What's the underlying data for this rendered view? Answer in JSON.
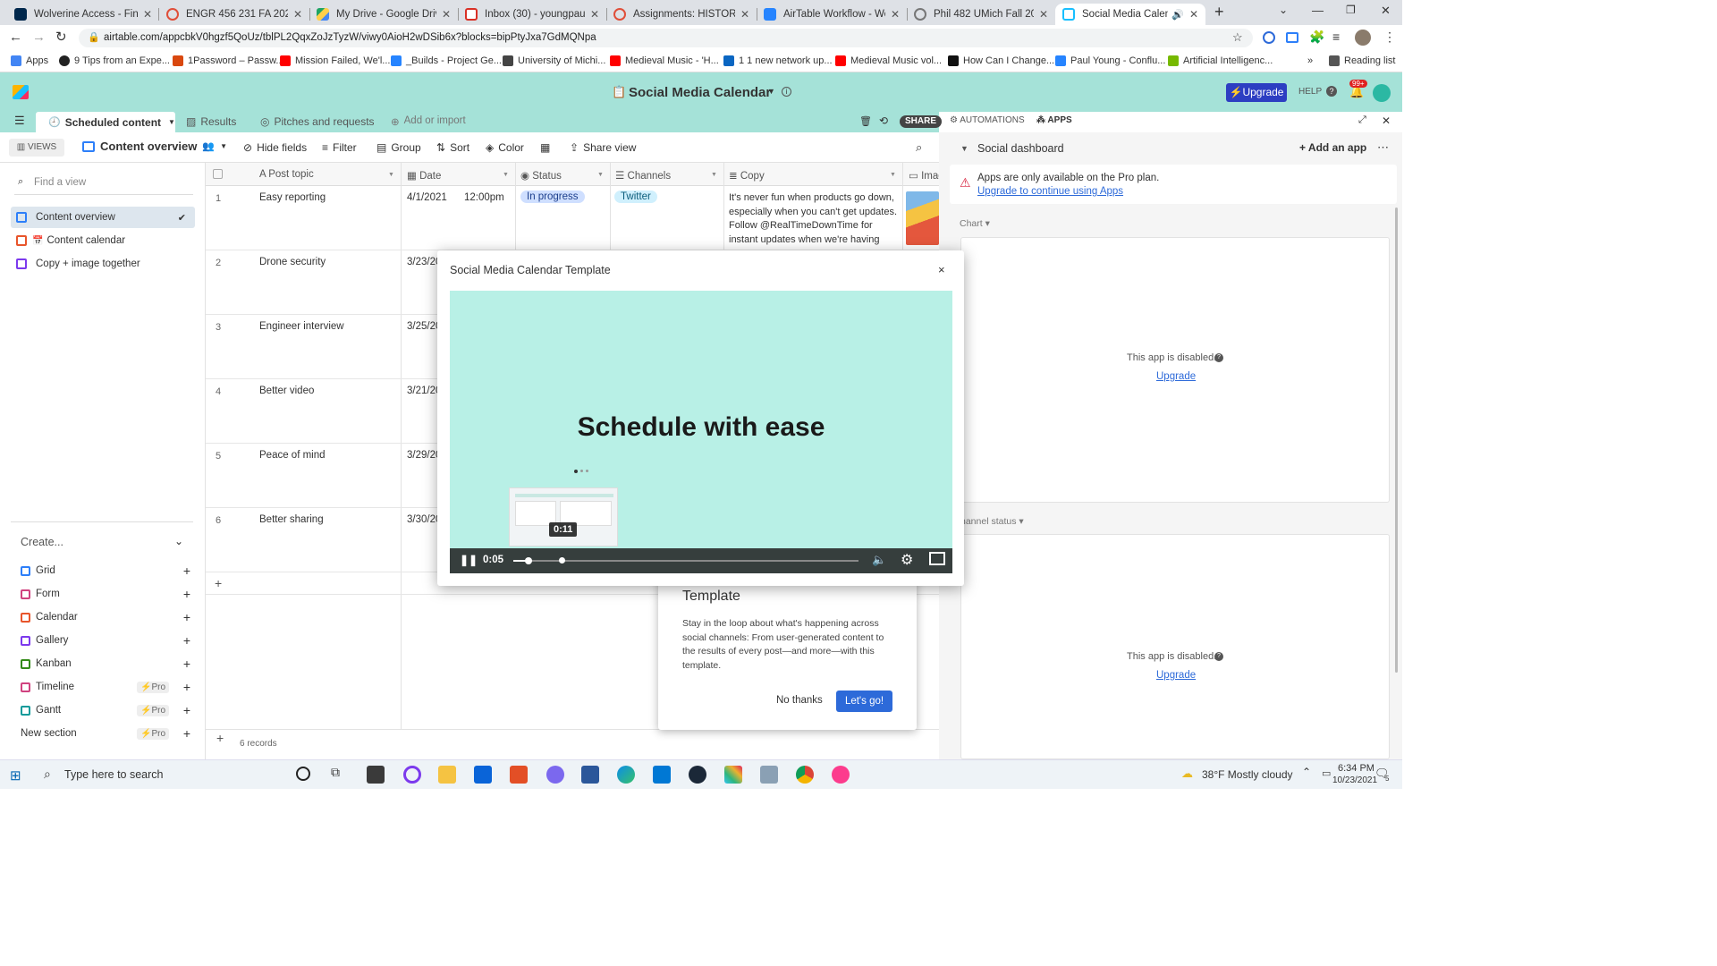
{
  "browser": {
    "tabs": [
      {
        "title": "Wolverine Access - Find &",
        "color": "#00274c"
      },
      {
        "title": "ENGR 456 231 FA 2021",
        "color": "#e04e39"
      },
      {
        "title": "My Drive - Google Drive",
        "color": "#1fa463"
      },
      {
        "title": "Inbox (30) - youngpau@u",
        "color": "#d93025"
      },
      {
        "title": "Assignments: HISTORY 49",
        "color": "#e04e39"
      },
      {
        "title": "AirTable Workflow - Wolve",
        "color": "#2684ff"
      },
      {
        "title": "Phil 482 UMich Fall 2021",
        "color": "#777777"
      },
      {
        "title": "Social Media Calenda",
        "color": "#18bfff"
      }
    ],
    "url": "airtable.com/appcbkV0hgzf5QoUz/tblPL2QqxZoJzTyzW/viwy0AioH2wDSib6x?blocks=bipPtyJxa7GdMQNpa",
    "bookmarks": [
      {
        "label": "Apps",
        "color": "#4285f4"
      },
      {
        "label": "9 Tips from an Expe...",
        "color": "#222222"
      },
      {
        "label": "1Password – Passw...",
        "color": "#d9480f"
      },
      {
        "label": "Mission Failed, We'l...",
        "color": "#ff0000"
      },
      {
        "label": "_Builds - Project Ge...",
        "color": "#2684ff"
      },
      {
        "label": "University of Michi...",
        "color": "#444444"
      },
      {
        "label": "Medieval Music - 'H...",
        "color": "#ff0000"
      },
      {
        "label": "1 1 new network up...",
        "color": "#0a66c2"
      },
      {
        "label": "Medieval Music vol...",
        "color": "#ff0000"
      },
      {
        "label": "How Can I Change...",
        "color": "#111111"
      },
      {
        "label": "Paul Young - Conflu...",
        "color": "#2684ff"
      },
      {
        "label": "Artificial Intelligenc...",
        "color": "#76b900"
      }
    ],
    "reading_list": "Reading list"
  },
  "app": {
    "base_title": "Social Media Calendar",
    "upgrade": "Upgrade",
    "help": "HELP",
    "notif_count": "99+",
    "tables": [
      "Scheduled content",
      "Results",
      "Pitches and requests"
    ],
    "add_import": "Add or import",
    "share": "SHARE",
    "automations": "AUTOMATIONS",
    "apps": "APPS"
  },
  "viewbar": {
    "views": "VIEWS",
    "current_view": "Content overview",
    "hide_fields": "Hide fields",
    "filter": "Filter",
    "group": "Group",
    "sort": "Sort",
    "color": "Color",
    "share_view": "Share view"
  },
  "sidebar": {
    "find_placeholder": "Find a view",
    "views": [
      "Content overview",
      "Content calendar",
      "Copy + image together"
    ],
    "create": "Create...",
    "create_items": [
      {
        "label": "Grid",
        "color": "#2d7ff9",
        "pro": ""
      },
      {
        "label": "Form",
        "color": "#d0427f",
        "pro": ""
      },
      {
        "label": "Calendar",
        "color": "#e8552b",
        "pro": ""
      },
      {
        "label": "Gallery",
        "color": "#7c39ed",
        "pro": ""
      },
      {
        "label": "Kanban",
        "color": "#338a17",
        "pro": ""
      },
      {
        "label": "Timeline",
        "color": "#d0427f",
        "pro": "Pro"
      },
      {
        "label": "Gantt",
        "color": "#0f9a9a",
        "pro": "Pro"
      }
    ],
    "new_section": "New section",
    "new_section_pro": "Pro"
  },
  "grid": {
    "columns": [
      "Post topic",
      "Date",
      "Status",
      "Channels",
      "Copy",
      "Imag"
    ],
    "rows": [
      {
        "num": "1",
        "topic": "Easy reporting",
        "date": "4/1/2021",
        "time": "12:00pm",
        "status": "In progress",
        "channel": "Twitter",
        "copy": "It's never fun when products go down, especially when you can't get updates. Follow @RealTimeDownTime for instant updates when we're having issues."
      },
      {
        "num": "2",
        "topic": "Drone security",
        "date": "3/23/20",
        "time": "",
        "status": "",
        "channel": "",
        "copy": ""
      },
      {
        "num": "3",
        "topic": "Engineer interview",
        "date": "3/25/20",
        "time": "",
        "status": "",
        "channel": "",
        "copy": ""
      },
      {
        "num": "4",
        "topic": "Better video",
        "date": "3/21/20",
        "time": "",
        "status": "",
        "channel": "",
        "copy": ""
      },
      {
        "num": "5",
        "topic": "Peace of mind",
        "date": "3/29/20",
        "time": "",
        "status": "",
        "channel": "",
        "copy": ""
      },
      {
        "num": "6",
        "topic": "Better sharing",
        "date": "3/30/20",
        "time": "",
        "status": "",
        "channel": "",
        "copy": ""
      }
    ],
    "records": "6 records"
  },
  "rpanel": {
    "title": "Social dashboard",
    "add_app": "Add an app",
    "pro_notice": "Apps are only available on the Pro plan.",
    "pro_link": "Upgrade to continue using Apps",
    "chart_label": "Chart",
    "channel_status_label": "hannel status",
    "disabled": "This app is disabled.",
    "upgrade": "Upgrade"
  },
  "modal": {
    "title": "Social Media Calendar Template",
    "close": "×",
    "headline": "Schedule with ease",
    "preview_time": "0:11",
    "current_time": "0:05",
    "progress": 0.045
  },
  "template_card": {
    "title": "Template",
    "body": "Stay in the loop about what's happening across social channels: From user-generated content to the results of every post—and more—with this template.",
    "no_thanks": "No thanks",
    "lets_go": "Let's go!"
  },
  "taskbar": {
    "search_placeholder": "Type here to search",
    "weather": "38°F  Mostly cloudy",
    "time": "6:34 PM",
    "date": "10/23/2021",
    "notif": "5"
  }
}
